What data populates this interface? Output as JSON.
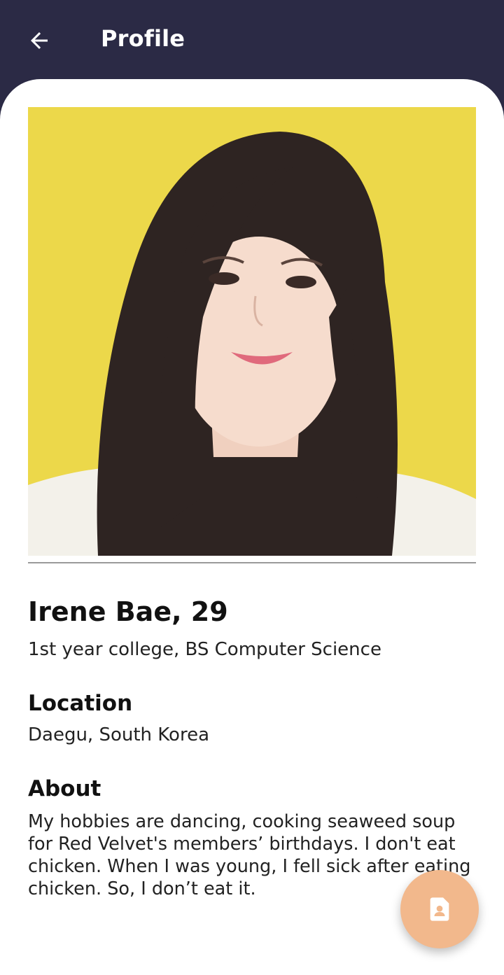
{
  "app_bar": {
    "title": "Profile",
    "back_icon": "arrow-left-icon"
  },
  "profile": {
    "photo_alt": "Irene Bae profile photo",
    "name_age": "Irene Bae, 29",
    "education": "1st year college, BS Computer Science",
    "location_heading": "Location",
    "location": "Daegu, South Korea",
    "about_heading": "About",
    "about": "My hobbies are dancing, cooking seaweed soup for Red Velvet's members’ birthdays. I don't eat chicken. When I was young, I fell sick after eating chicken. So, I don’t eat it."
  },
  "fab": {
    "icon": "contact-file-icon",
    "color": "#f2b88c"
  },
  "colors": {
    "app_bar": "#2b2a45",
    "photo_background": "#ecd84a"
  }
}
